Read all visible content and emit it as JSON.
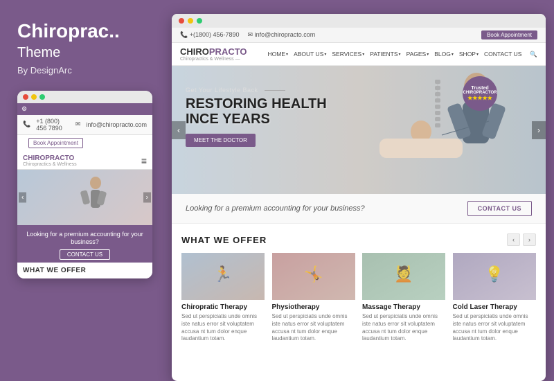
{
  "left": {
    "title": "Chiroprac..",
    "subtitle": "Theme",
    "author": "By DesignArc",
    "dots": [
      "red",
      "yellow",
      "green"
    ],
    "mobile": {
      "phone": "+1 (800) 456 7890",
      "email": "info@chiropracto.com",
      "book_btn": "Book Appointment",
      "logo_main_1": "CHIRO",
      "logo_main_2": "PRACTO",
      "logo_sub": "Chiropractics & Wellness",
      "cta_text": "Looking for a premium accounting for your business?",
      "contact_btn": "CONTACT US",
      "what_offer": "WHAT WE OFFER"
    }
  },
  "desktop": {
    "window_dots": [
      "red",
      "yellow",
      "green"
    ],
    "phone_bar": {
      "phone": "+(1800) 456-7890",
      "email": "info@chiropracto.com",
      "book_appointment": "Book Appointment"
    },
    "logo_1": "CHIRO",
    "logo_2": "PRACTO",
    "logo_sub": "Chiropractics & Wellness —",
    "nav": {
      "items": [
        "HOME",
        "ABOUT US",
        "SERVICES",
        "PATIENTS",
        "PAGES",
        "BLOG",
        "SHOP",
        "CONTACT US"
      ]
    },
    "hero": {
      "small_text": "Get Your Lifestyle Back",
      "title_line1": "RESTORING HEALTH",
      "title_line2": "INCE YEARS",
      "button": "MEET THE DOCTOR",
      "trusted": "Trusted\nCHIROPRACTOR",
      "stars": "★★★★★"
    },
    "cta_strip": {
      "text": "Looking for a premium accounting for your business?",
      "button": "CONTACT US"
    },
    "what_offer": {
      "title": "WHAT WE OFFER",
      "services": [
        {
          "name": "Chiropratic Therapy",
          "desc": "Sed ut perspiciatis unde omnis iste natus error sit voluptatem accusa nt tum dolor enque laudantium totam.",
          "color": "#b8c4d0",
          "icon": "🏃"
        },
        {
          "name": "Physiotherapy",
          "desc": "Sed ut perspiciatis unde omnis iste natus error sit voluptatem accusa nt tum dolor enque laudantium totam.",
          "color": "#c8b4b4",
          "icon": "🤸"
        },
        {
          "name": "Massage Therapy",
          "desc": "Sed ut perspiciatis unde omnis iste natus error sit voluptatem accusa nt tum dolor enque laudantium totam.",
          "color": "#b4c4b8",
          "icon": "💆"
        },
        {
          "name": "Cold Laser Therapy",
          "desc": "Sed ut perspiciatis unde omnis iste natus error sit voluptatem accusa nt tum dolor enque laudantium totam.",
          "color": "#c4b8c8",
          "icon": "💡"
        }
      ]
    }
  }
}
